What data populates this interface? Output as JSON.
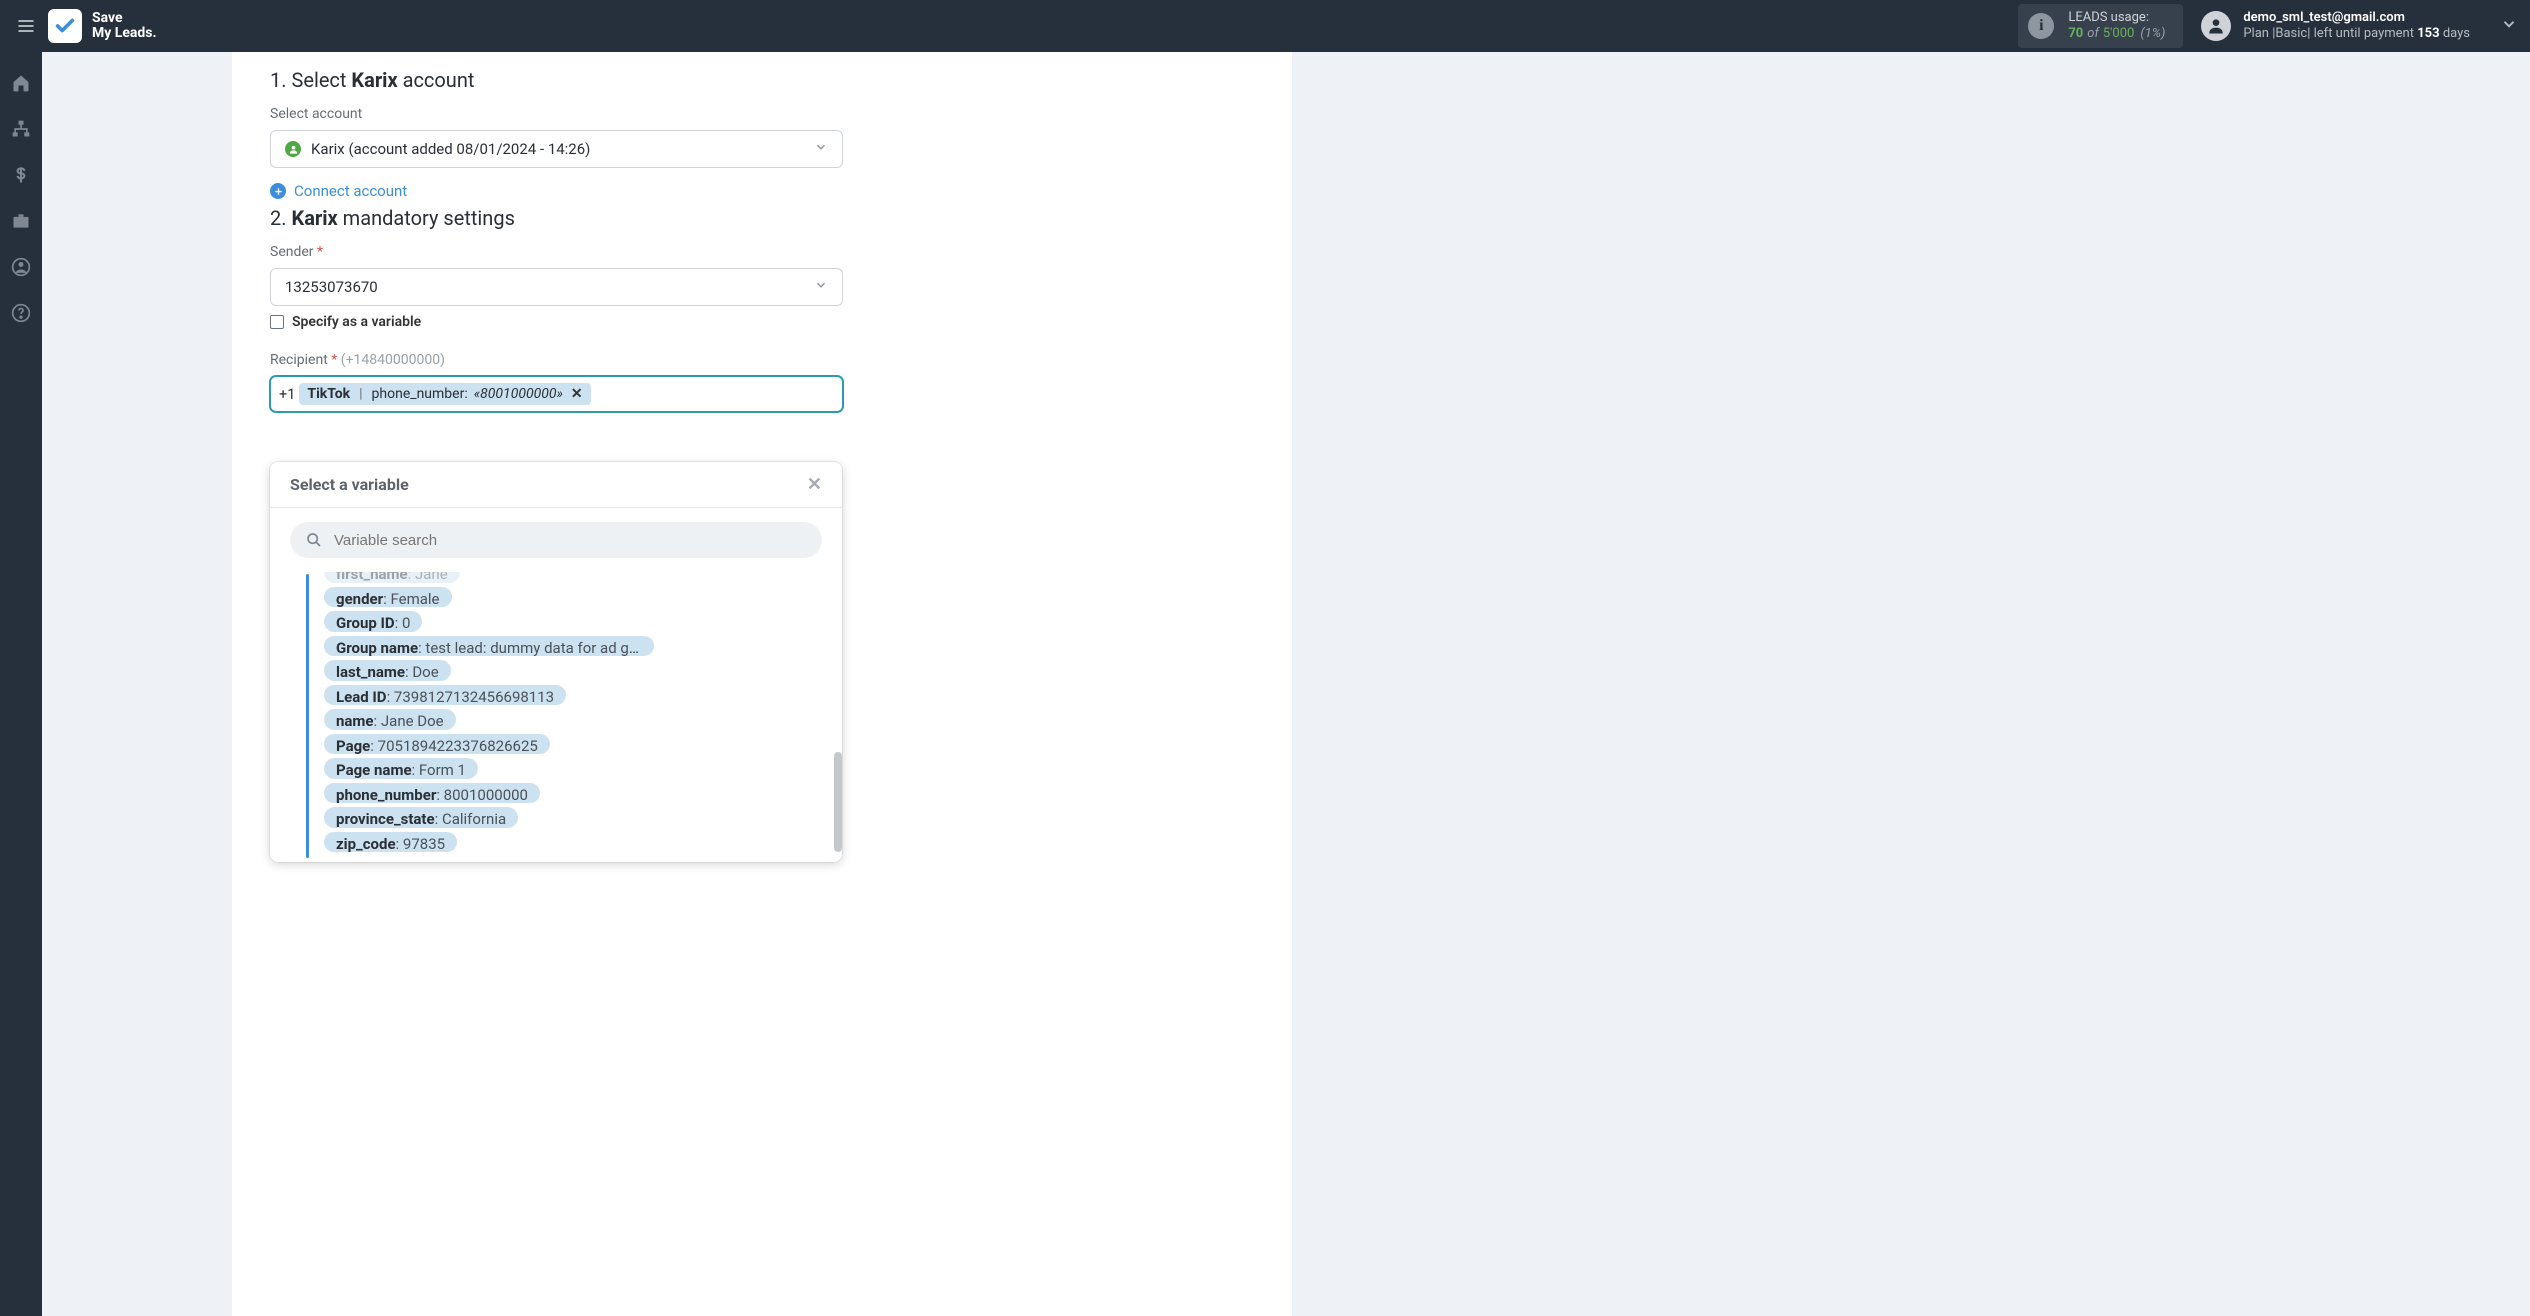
{
  "topbar": {
    "brand_line1": "Save",
    "brand_line2": "My Leads.",
    "usage": {
      "title": "LEADS usage:",
      "current": "70",
      "of": "of",
      "max": "5'000",
      "pct": "(1%)"
    },
    "account": {
      "email": "demo_sml_test@gmail.com",
      "plan_prefix": "Plan |Basic| left until payment ",
      "plan_days": "153",
      "plan_suffix": " days"
    }
  },
  "step1": {
    "prefix": "1. Select ",
    "bold": "Karix",
    "suffix": " account",
    "select_label": "Select account",
    "selected": "Karix (account added 08/01/2024 - 14:26)",
    "connect": "Connect account"
  },
  "step2": {
    "prefix": "2. ",
    "bold": "Karix",
    "suffix": " mandatory settings",
    "sender_label": "Sender",
    "sender_value": "13253073670",
    "checkbox_label": "Specify as a variable",
    "recipient_label": "Recipient",
    "recipient_hint": "(+14840000000)",
    "recipient_prefix": "+1",
    "tag": {
      "source": "TikTok",
      "field": "phone_number:",
      "value": "«8001000000»"
    }
  },
  "popover": {
    "title": "Select a variable",
    "search_placeholder": "Variable search",
    "items": [
      {
        "key": "first_name",
        "val": "Jane"
      },
      {
        "key": "gender",
        "val": "Female"
      },
      {
        "key": "Group ID",
        "val": "0"
      },
      {
        "key": "Group name",
        "val": "test lead: dummy data for ad g …"
      },
      {
        "key": "last_name",
        "val": "Doe"
      },
      {
        "key": "Lead ID",
        "val": "7398127132456698113"
      },
      {
        "key": "name",
        "val": "Jane Doe"
      },
      {
        "key": "Page",
        "val": "7051894223376826625"
      },
      {
        "key": "Page name",
        "val": "Form 1"
      },
      {
        "key": "phone_number",
        "val": "8001000000"
      },
      {
        "key": "province_state",
        "val": "California"
      },
      {
        "key": "zip_code",
        "val": "97835"
      }
    ]
  }
}
